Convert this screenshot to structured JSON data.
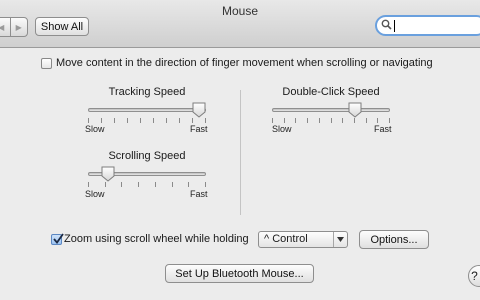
{
  "window": {
    "title": "Mouse"
  },
  "toolbar": {
    "show_all_label": "Show All",
    "search_value": ""
  },
  "scroll_direction": {
    "label": "Move content in the direction of finger movement when scrolling or navigating",
    "checked": false
  },
  "tracking_speed": {
    "title": "Tracking Speed",
    "min_label": "Slow",
    "max_label": "Fast",
    "level": 0.94
  },
  "scrolling_speed": {
    "title": "Scrolling Speed",
    "min_label": "Slow",
    "max_label": "Fast",
    "level": 0.17
  },
  "double_click_speed": {
    "title": "Double-Click Speed",
    "min_label": "Slow",
    "max_label": "Fast",
    "level": 0.7
  },
  "zoom": {
    "label": "Zoom using scroll wheel while holding",
    "checked": true,
    "modifier_value": "^ Control",
    "options_label": "Options..."
  },
  "bluetooth": {
    "setup_label": "Set Up Bluetooth Mouse..."
  },
  "help": {
    "label": "?"
  }
}
